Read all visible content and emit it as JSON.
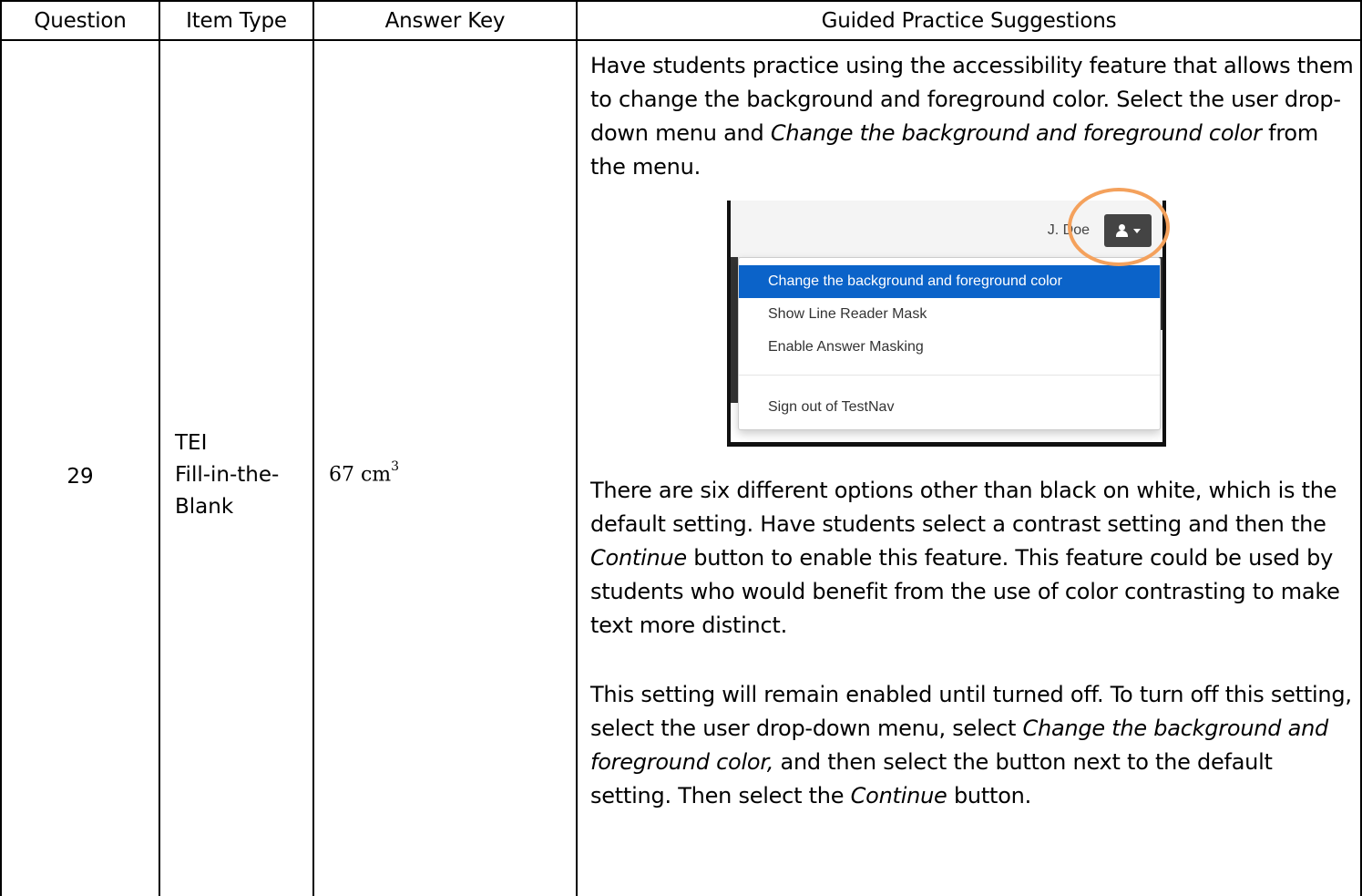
{
  "table": {
    "headers": {
      "question": "Question",
      "item_type": "Item Type",
      "answer_key": "Answer Key",
      "guided": "Guided Practice Suggestions"
    },
    "row": {
      "question": "29",
      "item_type_line1": "TEI",
      "item_type_line2": "Fill-in-the-",
      "item_type_line3": "Blank",
      "answer_value": "67 cm",
      "answer_exponent": "3"
    }
  },
  "guided": {
    "p1_a": "Have students practice using the accessibility feature that allows them to change the background and foreground color.  Select the user drop-down menu and ",
    "p1_em": "Change the background and foreground color",
    "p1_b": " from the menu.",
    "p2_a": "There are six different options other than black on white, which is the default setting.  Have students select a contrast setting and then the ",
    "p2_em": "Continue",
    "p2_b": " button to enable this feature. This feature could be used by students who would benefit from the use of color contrasting to make text more distinct.",
    "p3_a": "This setting will remain enabled until turned off.  To turn off this setting, select the user drop-down menu, select ",
    "p3_em1": "Change the background and foreground color,",
    "p3_b": " and then select the button next to the default setting.  Then select the ",
    "p3_em2": "Continue",
    "p3_c": " button."
  },
  "screenshot": {
    "user_name": "J. Doe",
    "user_icon": "user-icon",
    "menu_items": [
      "Change the background and foreground color",
      "Show Line Reader Mask",
      "Enable Answer Masking",
      "Sign out of TestNav"
    ],
    "highlight_color": "#0b63c9",
    "ring_color": "#f4a15c"
  }
}
